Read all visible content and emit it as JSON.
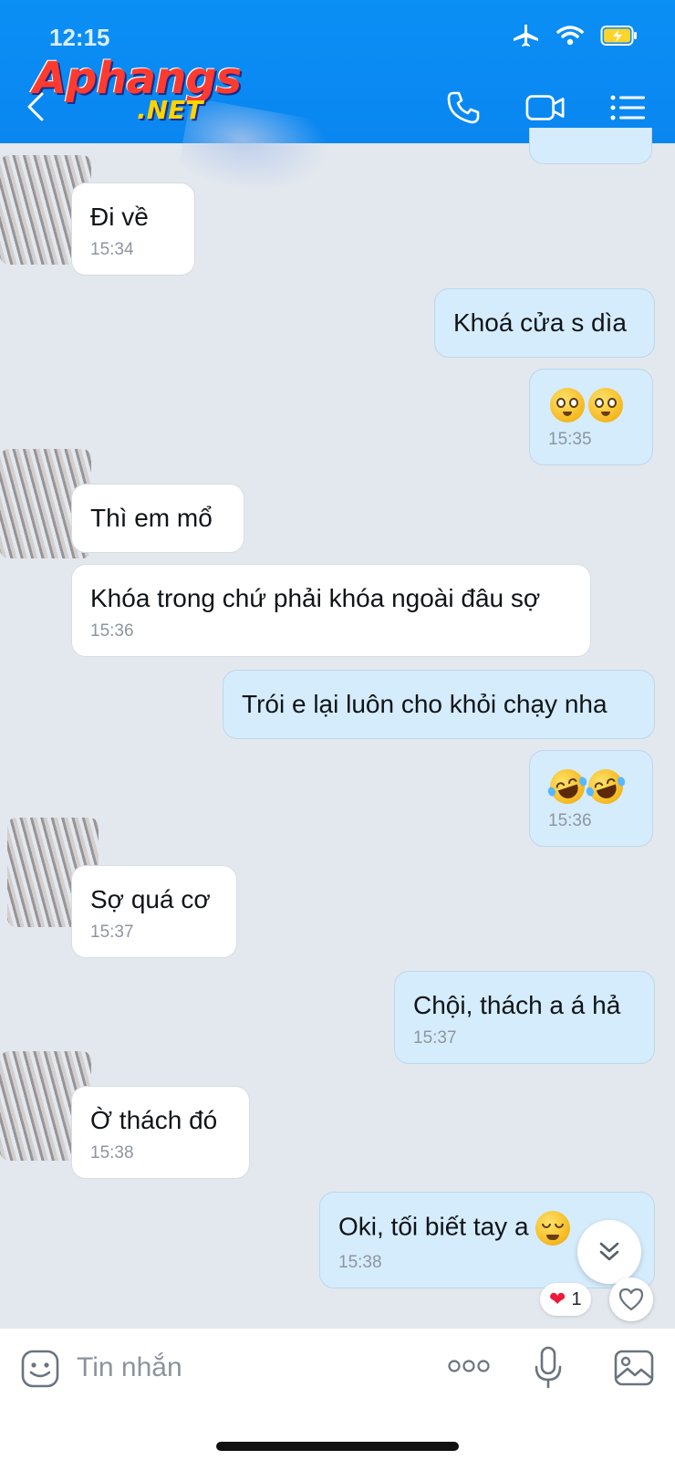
{
  "status_bar": {
    "time": "12:15"
  },
  "watermark": {
    "brand_main": "Aphangs",
    "brand_sub": ".NET"
  },
  "header": {
    "back_icon": "chevron-left-icon",
    "actions": [
      "phone-icon",
      "video-icon",
      "menu-icon"
    ]
  },
  "messages": [
    {
      "side": "in",
      "text": "Đi về",
      "time": "15:34"
    },
    {
      "side": "out",
      "text": "Khoá cửa s dìa",
      "time": ""
    },
    {
      "side": "out",
      "emoji": [
        "pleading-face",
        "pleading-face"
      ],
      "time": "15:35"
    },
    {
      "side": "in",
      "text": "Thì em mổ",
      "time": ""
    },
    {
      "side": "in",
      "text": "Khóa trong chứ phải khóa ngoài đâu sợ",
      "time": "15:36"
    },
    {
      "side": "out",
      "text": "Trói e lại luôn cho khỏi chạy nha",
      "time": ""
    },
    {
      "side": "out",
      "emoji": [
        "rolling-laughing-face",
        "rolling-laughing-face"
      ],
      "time": "15:36"
    },
    {
      "side": "in",
      "text": "Sợ quá cơ",
      "time": "15:37"
    },
    {
      "side": "out",
      "text": "Chội, thách a á hả",
      "time": "15:37"
    },
    {
      "side": "in",
      "text": "Ờ thách đó",
      "time": "15:38"
    },
    {
      "side": "out",
      "text": "Oki, tối biết tay a",
      "time": "15:38"
    }
  ],
  "reaction": {
    "emoji": "heart",
    "count": "1"
  },
  "composer": {
    "placeholder": "Tin nhắn"
  }
}
